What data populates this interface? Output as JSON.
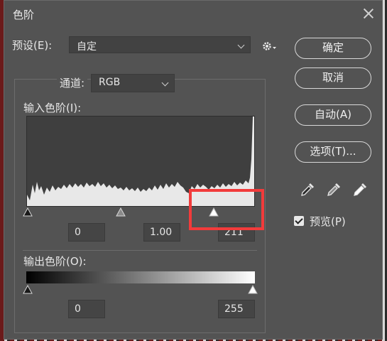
{
  "window": {
    "title": "色阶"
  },
  "preset": {
    "label": "预设(E):",
    "value": "自定"
  },
  "channel": {
    "label": "通道:",
    "value": "RGB"
  },
  "input_levels": {
    "label": "输入色阶(I):",
    "black": "0",
    "gamma": "1.00",
    "white": "211"
  },
  "output_levels": {
    "label": "输出色阶(O):",
    "black": "0",
    "white": "255"
  },
  "buttons": {
    "ok": "确定",
    "cancel": "取消",
    "auto": "自动(A)",
    "options": "选项(T)..."
  },
  "preview": {
    "label": "预览(P)",
    "checked": true
  },
  "icons": {
    "settings": "gear-icon",
    "close": "close-icon",
    "droppers": [
      "black-eyedropper-icon",
      "gray-eyedropper-icon",
      "white-eyedropper-icon"
    ]
  },
  "colors": {
    "dialog_bg": "#535353",
    "highlight": "#f23b3b"
  }
}
